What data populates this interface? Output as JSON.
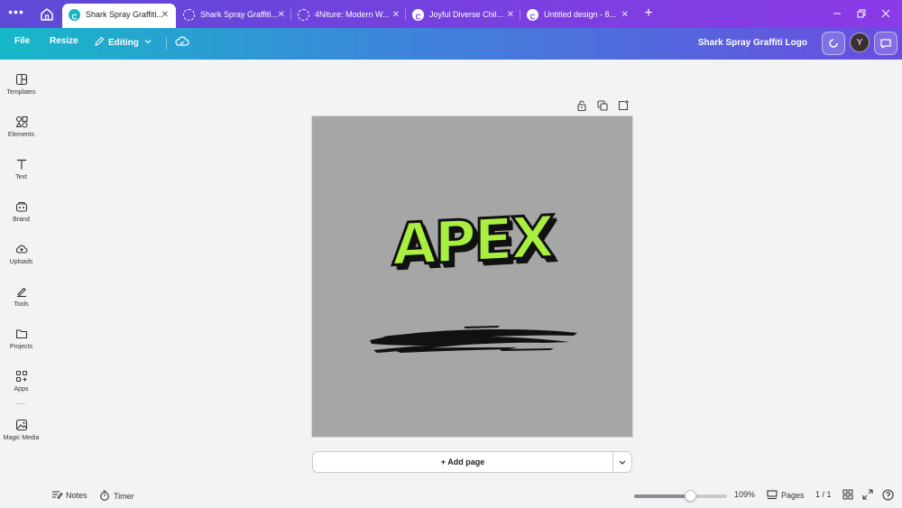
{
  "browser": {
    "tabs": [
      {
        "label": "Shark Spray Graffiti...",
        "active": true
      },
      {
        "label": "Shark Spray Graffiti...",
        "active": false
      },
      {
        "label": "4Niture: Modern W...",
        "active": false
      },
      {
        "label": "Joyful Diverse Chil...",
        "active": false
      },
      {
        "label": "Untitled design - 8...",
        "active": false
      }
    ],
    "close_glyph": "✕",
    "new_tab_glyph": "+"
  },
  "toolbar": {
    "file_label": "File",
    "resize_label": "Resize",
    "editing_label": "Editing",
    "design_title": "Shark Spray Graffiti Logo",
    "avatar_initial": "Y"
  },
  "sidebar": {
    "items": [
      {
        "label": "Templates",
        "icon": "templates-icon"
      },
      {
        "label": "Elements",
        "icon": "elements-icon"
      },
      {
        "label": "Text",
        "icon": "text-icon"
      },
      {
        "label": "Brand",
        "icon": "brand-icon"
      },
      {
        "label": "Uploads",
        "icon": "uploads-icon"
      },
      {
        "label": "Tools",
        "icon": "tools-icon"
      },
      {
        "label": "Projects",
        "icon": "projects-icon"
      },
      {
        "label": "Apps",
        "icon": "apps-icon"
      },
      {
        "label": "Magic Media",
        "icon": "magic-media-icon"
      }
    ]
  },
  "canvas": {
    "headline": "APEX",
    "background_color": "#a6a6a6",
    "text_color": "#a8ef3f",
    "add_page_label": "+ Add page"
  },
  "footer": {
    "notes_label": "Notes",
    "timer_label": "Timer",
    "zoom_label": "109%",
    "zoom_fraction": 0.6,
    "pages_label": "Pages",
    "page_count": "1 / 1"
  },
  "colors": {
    "accent_start": "#17b8c8",
    "accent_end": "#6a4ce0",
    "tabbar": "#7b3fe0"
  }
}
